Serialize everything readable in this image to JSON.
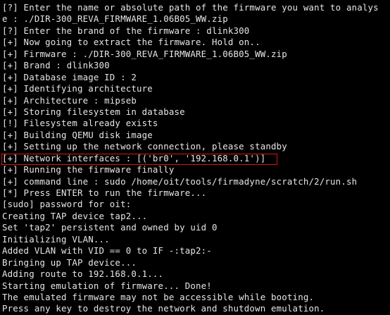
{
  "terminal": {
    "lines": [
      "[?] Enter the name or absolute path of the firmware you want to analys",
      "e : ./DIR-300_REVA_FIRMWARE_1.06B05_WW.zip",
      "[?] Enter the brand of the firmware : dlink300",
      "[+] Now going to extract the firmware. Hold on..",
      "[+] Firmware : ./DIR-300_REVA_FIRMWARE_1.06B05_WW.zip",
      "[+] Brand : dlink300",
      "[+] Database image ID : 2",
      "[+] Identifying architecture",
      "[+] Architecture : mipseb",
      "[+] Storing filesystem in database",
      "[!] Filesystem already exists",
      "[+] Building QEMU disk image",
      "[+] Setting up the network connection, please standby",
      "[+] Network interfaces : [('br0', '192.168.0.1')]",
      "[+] Running the firmware finally",
      "[+] command line : sudo /home/oit/tools/firmadyne/scratch/2/run.sh",
      "[*] Press ENTER to run the firmware...",
      "[sudo] password for oit:",
      "Creating TAP device tap2...",
      "Set 'tap2' persistent and owned by uid 0",
      "Initializing VLAN...",
      "Added VLAN with VID == 0 to IF -:tap2:-",
      "Bringing up TAP device...",
      "Adding route to 192.168.0.1...",
      "Starting emulation of firmware... Done!",
      "The emulated firmware may not be accessible while booting.",
      "Press any key to destroy the network and shutdown emulation."
    ]
  }
}
